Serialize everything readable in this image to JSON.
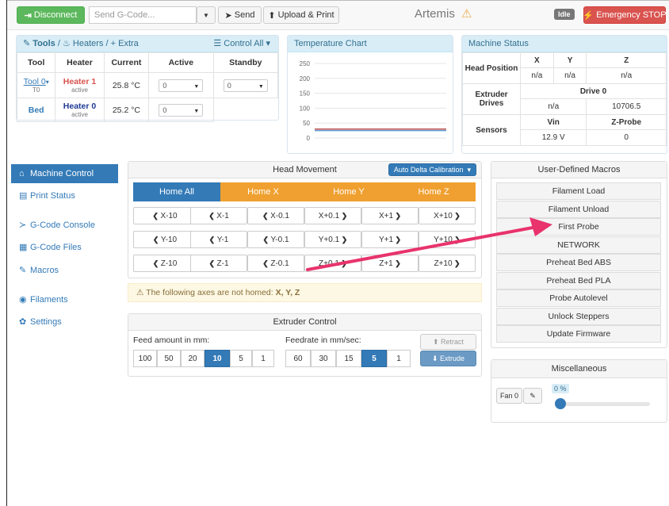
{
  "topbar": {
    "disconnect": "Disconnect",
    "gcode_placeholder": "Send G-Code...",
    "send": "Send",
    "upload_print": "Upload & Print",
    "machine_name": "Artemis",
    "status": "Idle",
    "emergency": "Emergency STOP"
  },
  "tools_panel": {
    "title_tools": "Tools",
    "title_heaters": "Heaters",
    "title_extra": "Extra",
    "control_all": "Control All",
    "headers": [
      "Tool",
      "Heater",
      "Current",
      "Active",
      "Standby"
    ],
    "rows": [
      {
        "tool": "Tool 0",
        "tool_sub": "T0",
        "heater": "Heater 1",
        "heater_state": "active",
        "current": "25.8 °C",
        "active": "0",
        "standby": "0"
      },
      {
        "tool": "Bed",
        "heater": "Heater 0",
        "heater_state": "active",
        "current": "25.2 °C",
        "active": "0"
      }
    ]
  },
  "temp_chart": {
    "title": "Temperature Chart",
    "y_ticks": [
      "250",
      "200",
      "150",
      "100",
      "50",
      "0"
    ]
  },
  "chart_data": {
    "type": "line",
    "title": "Temperature Chart",
    "ylim": [
      0,
      250
    ],
    "y_ticks": [
      0,
      50,
      100,
      150,
      200,
      250
    ],
    "series": [
      {
        "values": [
          30,
          30
        ],
        "color": "#c0504d"
      },
      {
        "values": [
          25,
          25
        ],
        "color": "#5b9bd5"
      }
    ]
  },
  "machine_status": {
    "title": "Machine Status",
    "head_position": "Head Position",
    "axes": [
      "X",
      "Y",
      "Z"
    ],
    "positions": [
      "n/a",
      "n/a",
      "n/a"
    ],
    "extruder_drives": "Extruder Drives",
    "drive_label": "Drive 0",
    "drive_values": [
      "n/a",
      "10706.5"
    ],
    "sensors": "Sensors",
    "vin_label": "Vin",
    "zprobe_label": "Z-Probe",
    "vin": "12.9 V",
    "zprobe": "0"
  },
  "sidebar": {
    "items": [
      {
        "label": "Machine Control",
        "icon": "home-icon"
      },
      {
        "label": "Print Status",
        "icon": "print-icon"
      },
      {
        "label": "G-Code Console",
        "icon": "terminal-icon"
      },
      {
        "label": "G-Code Files",
        "icon": "files-icon"
      },
      {
        "label": "Macros",
        "icon": "wrench-icon"
      },
      {
        "label": "Filaments",
        "icon": "filament-icon"
      },
      {
        "label": "Settings",
        "icon": "gear-icon"
      }
    ]
  },
  "head_movement": {
    "title": "Head Movement",
    "auto_delta": "Auto Delta Calibration",
    "home_all": "Home All",
    "home_x": "Home X",
    "home_y": "Home Y",
    "home_z": "Home Z",
    "rows": [
      [
        "X-10",
        "X-1",
        "X-0.1",
        "X+0.1",
        "X+1",
        "X+10"
      ],
      [
        "Y-10",
        "Y-1",
        "Y-0.1",
        "Y+0.1",
        "Y+1",
        "Y+10"
      ],
      [
        "Z-10",
        "Z-1",
        "Z-0.1",
        "Z+0.1",
        "Z+1",
        "Z+10"
      ]
    ]
  },
  "warning": {
    "text": "The following axes are not homed:",
    "axes": "X, Y, Z"
  },
  "extruder": {
    "title": "Extruder Control",
    "feed_label": "Feed amount in mm:",
    "feed_values": [
      "100",
      "50",
      "20",
      "10",
      "5",
      "1"
    ],
    "feed_selected": "10",
    "rate_label": "Feedrate in mm/sec:",
    "rate_values": [
      "60",
      "30",
      "15",
      "5",
      "1"
    ],
    "rate_selected": "5",
    "retract": "Retract",
    "extrude": "Extrude"
  },
  "macros": {
    "title": "User-Defined Macros",
    "items": [
      "Filament Load",
      "Filament Unload",
      "First Probe",
      "NETWORK",
      "Preheat Bed ABS",
      "Preheat Bed PLA",
      "Probe Autolevel",
      "Unlock Steppers",
      "Update Firmware"
    ]
  },
  "misc": {
    "title": "Miscellaneous",
    "fan": "Fan 0",
    "fan_value": "0 %",
    "fan_percent": 0
  },
  "annotation": {
    "arrow_color": "#e8336d"
  }
}
